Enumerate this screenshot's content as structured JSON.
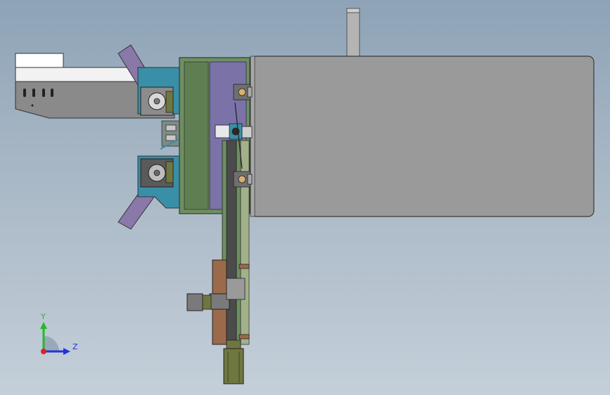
{
  "view": {
    "background_top": "#8ea3b7",
    "background_bottom": "#c4cfd9"
  },
  "triad": {
    "y_label": "Y",
    "z_label": "Z",
    "y_color": "#27b827",
    "z_color": "#2233dd",
    "x_color": "#dd2222"
  },
  "colors": {
    "housing": "#9a9a9a",
    "frame_green": "#6f8f62",
    "panel_purple": "#7b72a8",
    "fin_purple": "#8a78a8",
    "bracket_teal": "#3a8fa8",
    "motor_gray": "#8c8c8c",
    "motor_olive": "#6f7740",
    "rail_brown": "#9a6a4a",
    "post_gray": "#b4b4b4",
    "arm_white": "#f2f2f2"
  }
}
